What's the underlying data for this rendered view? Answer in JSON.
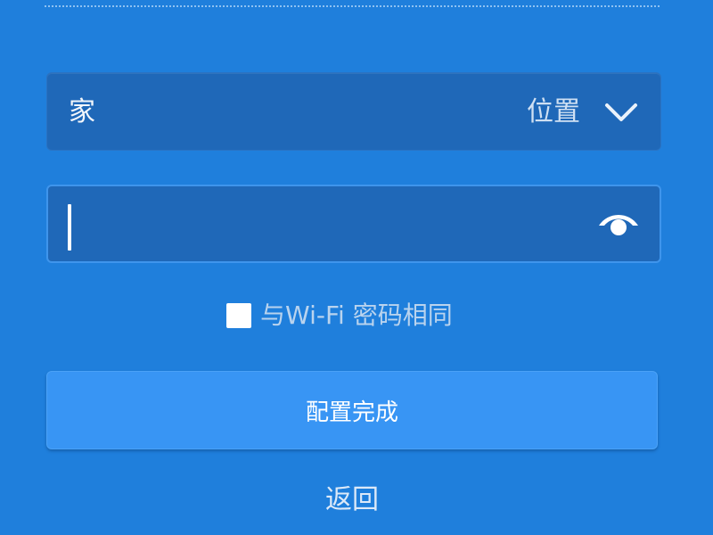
{
  "location": {
    "value": "家",
    "label": "位置"
  },
  "password": {
    "value": "",
    "placeholder": ""
  },
  "same_as_wifi": {
    "label": "与Wi-Fi 密码相同",
    "checked": false
  },
  "actions": {
    "confirm_label": "配置完成",
    "back_label": "返回"
  },
  "colors": {
    "background": "#1f7fdc",
    "field": "#1f68b8",
    "button": "#3895f4",
    "text": "#ffffff"
  },
  "icons": {
    "dropdown": "chevron-down-icon",
    "visibility": "eye-icon"
  }
}
